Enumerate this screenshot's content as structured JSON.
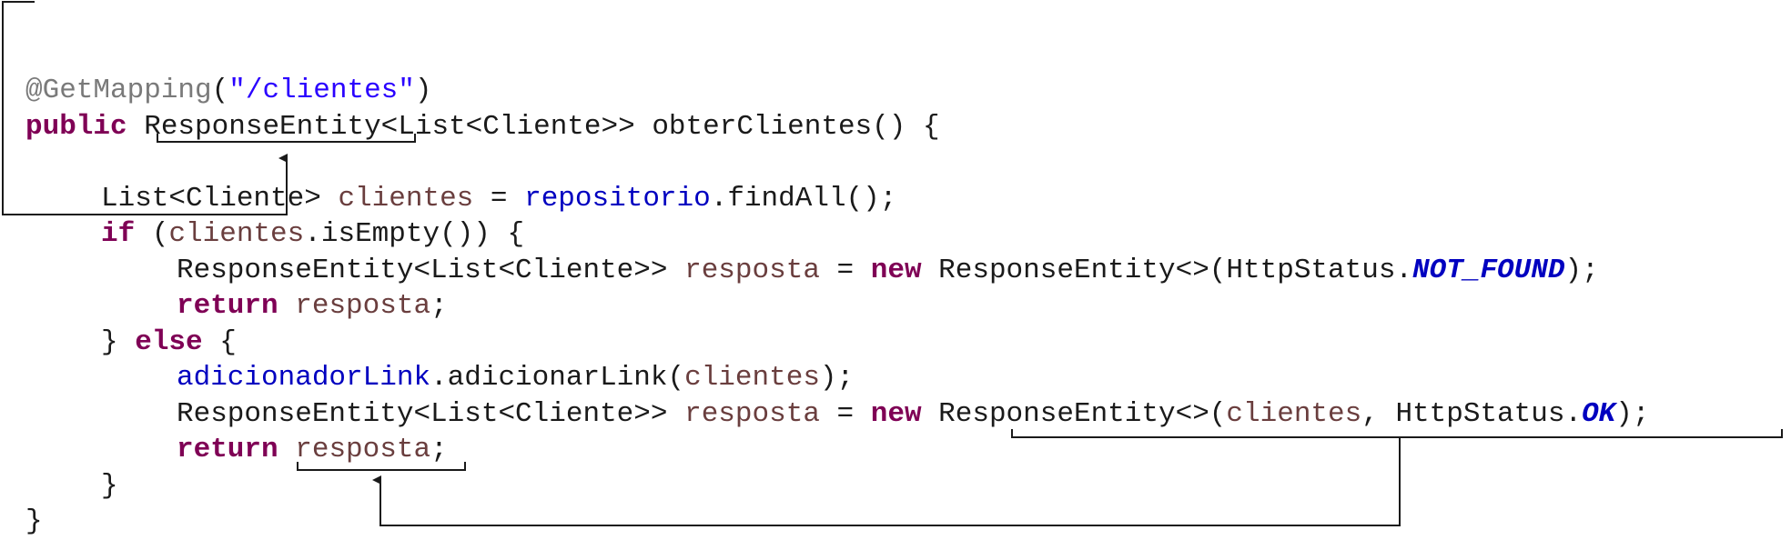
{
  "code_lines": [
    {
      "indent": 0,
      "tokens": [
        {
          "t": "@GetMapping",
          "c": "ann"
        },
        {
          "t": "(",
          "c": "plain"
        },
        {
          "t": "\"/clientes\"",
          "c": "str"
        },
        {
          "t": ")",
          "c": "plain"
        }
      ]
    },
    {
      "indent": 0,
      "tokens": [
        {
          "t": "public",
          "c": "kw"
        },
        {
          "t": " ResponseEntity<List<Cliente>> obterClientes() {",
          "c": "plain"
        }
      ]
    },
    {
      "indent": 0,
      "tokens": []
    },
    {
      "indent": 1,
      "tokens": [
        {
          "t": "List<Cliente> ",
          "c": "plain"
        },
        {
          "t": "clientes",
          "c": "var"
        },
        {
          "t": " = ",
          "c": "plain"
        },
        {
          "t": "repositorio",
          "c": "field"
        },
        {
          "t": ".findAll();",
          "c": "plain"
        }
      ]
    },
    {
      "indent": 1,
      "tokens": [
        {
          "t": "if",
          "c": "kw"
        },
        {
          "t": " (",
          "c": "plain"
        },
        {
          "t": "clientes",
          "c": "var"
        },
        {
          "t": ".isEmpty()) {",
          "c": "plain"
        }
      ]
    },
    {
      "indent": 2,
      "tokens": [
        {
          "t": "ResponseEntity<List<Cliente>> ",
          "c": "plain"
        },
        {
          "t": "resposta",
          "c": "var"
        },
        {
          "t": " = ",
          "c": "plain"
        },
        {
          "t": "new",
          "c": "kw"
        },
        {
          "t": " ResponseEntity<>(HttpStatus.",
          "c": "plain"
        },
        {
          "t": "NOT_FOUND",
          "c": "const"
        },
        {
          "t": ");",
          "c": "plain"
        }
      ]
    },
    {
      "indent": 2,
      "tokens": [
        {
          "t": "return",
          "c": "kw"
        },
        {
          "t": " ",
          "c": "plain"
        },
        {
          "t": "resposta",
          "c": "var"
        },
        {
          "t": ";",
          "c": "plain"
        }
      ]
    },
    {
      "indent": 1,
      "tokens": [
        {
          "t": "} ",
          "c": "plain"
        },
        {
          "t": "else",
          "c": "kw"
        },
        {
          "t": " {",
          "c": "plain"
        }
      ]
    },
    {
      "indent": 2,
      "tokens": [
        {
          "t": "adicionadorLink",
          "c": "field"
        },
        {
          "t": ".adicionarLink(",
          "c": "plain"
        },
        {
          "t": "clientes",
          "c": "var"
        },
        {
          "t": ");",
          "c": "plain"
        }
      ]
    },
    {
      "indent": 2,
      "tokens": [
        {
          "t": "ResponseEntity<List<Cliente>> ",
          "c": "plain"
        },
        {
          "t": "resposta",
          "c": "var"
        },
        {
          "t": " = ",
          "c": "plain"
        },
        {
          "t": "new",
          "c": "kw"
        },
        {
          "t": " ResponseEntity<>(",
          "c": "plain"
        },
        {
          "t": "clientes",
          "c": "var"
        },
        {
          "t": ", HttpStatus.",
          "c": "plain"
        },
        {
          "t": "OK",
          "c": "const"
        },
        {
          "t": ");",
          "c": "plain"
        }
      ]
    },
    {
      "indent": 2,
      "tokens": [
        {
          "t": "return",
          "c": "kw"
        },
        {
          "t": " ",
          "c": "plain"
        },
        {
          "t": "resposta",
          "c": "var"
        },
        {
          "t": ";",
          "c": "plain"
        }
      ]
    },
    {
      "indent": 1,
      "tokens": [
        {
          "t": "}",
          "c": "plain"
        }
      ]
    },
    {
      "indent": 0,
      "tokens": [
        {
          "t": "}",
          "c": "plain"
        }
      ]
    }
  ],
  "colors": {
    "annotation": "#7a7a7a",
    "keyword": "#7f0055",
    "string": "#2a00ff",
    "variable": "#6a3e3e",
    "field": "#0000c0",
    "constant": "#0000c0",
    "connector": "#1a1a1a"
  }
}
